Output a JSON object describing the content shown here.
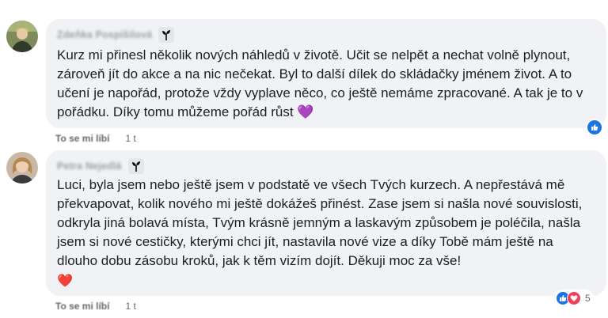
{
  "comments": [
    {
      "author": "Zdeňka Pospíšilová",
      "text": "Kurz mi přinesl několik nových náhledů v životě. Učit se nelpět a nechat volně plynout, zároveň jít do akce a na nic nečekat. Byl to další dílek do skládačky jménem život. A to učení je napořád, protože vždy vyplave něco, co ještě nemáme zpracované. A tak je to v pořádku. Díky tomu můžeme pořád růst 💜",
      "like_label": "To se mi líbí",
      "time": "1 t",
      "reactions": [
        "like-icon"
      ]
    },
    {
      "author": "Petra Nejedlá",
      "text": "Luci, byla jsem nebo ještě jsem v podstatě ve všech Tvých kurzech. A nepřestává mě překvapovat, kolik nového mi ještě dokážeš přinést. Zase jsem si našla nové souvislosti, odkryla jiná bolavá místa, Tvým krásně jemným a laskavým způsobem je poléčila, našla jsem si nové cestičky, kterými chci jít, nastavila nové vize a díky Tobě mám ještě na dlouho dobu zásobu kroků, jak k těm vizím dojít. Děkuji moc za vše!",
      "emoji": "❤️",
      "like_label": "To se mi líbí",
      "time": "1 t",
      "reactions": [
        "like-icon",
        "love-icon"
      ],
      "reaction_count": "5"
    }
  ],
  "colors": {
    "bubble": "#f0f2f5",
    "like_blue": "#1b74e4",
    "heart_red": "#f33e58",
    "meta_gray": "#65676b"
  }
}
